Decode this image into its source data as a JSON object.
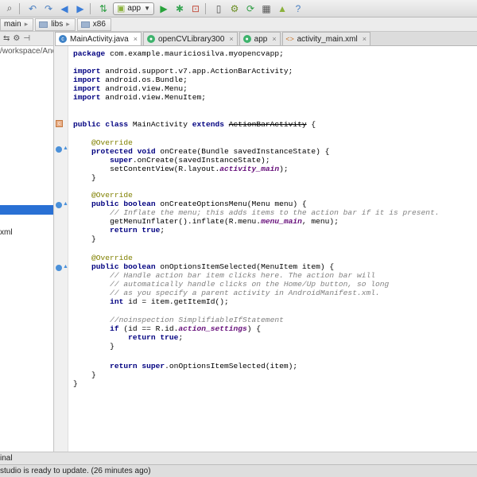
{
  "toolbar": {
    "icons": [
      "search-icon",
      "undo-icon",
      "redo-icon",
      "back-icon",
      "forward-icon",
      "build-icon",
      "run-icon",
      "debug-icon",
      "attach-debugger-icon",
      "avd-icon",
      "sdk-manager-icon",
      "sync-icon",
      "device-monitor-icon",
      "android-icon",
      "help-icon"
    ],
    "run_config_label": "app"
  },
  "breadcrumb": {
    "items": [
      "main",
      "libs",
      "x86"
    ]
  },
  "project_panel": {
    "path_text": "/workspace/And",
    "xml_item_text": "xml"
  },
  "tabs": [
    {
      "label": "MainActivity.java",
      "icon": "class-icon",
      "active": true
    },
    {
      "label": "openCVLibrary300",
      "icon": "module-icon",
      "active": false
    },
    {
      "label": "app",
      "icon": "module-icon",
      "active": false
    },
    {
      "label": "activity_main.xml",
      "icon": "xml-file-icon",
      "active": false
    }
  ],
  "code": {
    "package_kw": "package",
    "package_name": " com.example.mauriciosilva.myopencvapp;",
    "import_kw": "import",
    "imports": [
      " android.support.v7.app.ActionBarActivity;",
      " android.os.Bundle;",
      " android.view.Menu;",
      " android.view.MenuItem;"
    ],
    "class_public": "public",
    "class_kw": "class",
    "class_name": " MainActivity ",
    "extends_kw": "extends",
    "super_class": "ActionBarActivity",
    "brace_open": " {",
    "override": "@Override",
    "protected_kw": "protected",
    "void_kw": "void",
    "oncreate_sig": " onCreate(Bundle savedInstanceState) {",
    "super_kw": "super",
    "oncreate_super": ".onCreate(savedInstanceState);",
    "setcontent_start": "setContentView(R.layout.",
    "activity_main_field": "activity_main",
    "close_paren_semi": ");",
    "close_brace": "}",
    "public_kw": "public",
    "boolean_kw": "boolean",
    "oncreateoptions_sig": " onCreateOptionsMenu(Menu menu) {",
    "comment_inflate": "// Inflate the menu; this adds items to the action bar if it is present.",
    "inflate_start": "getMenuInflater().inflate(R.menu.",
    "menu_main_field": "menu_main",
    "inflate_end": ", menu);",
    "return_kw": "return",
    "true_kw": "true",
    "semi": ";",
    "onoptions_sig": " onOptionsItemSelected(MenuItem item) {",
    "comment_1": "// Handle action bar item clicks here. The action bar will",
    "comment_2": "// automatically handle clicks on the Home/Up button, so long",
    "comment_3": "// as you specify a parent activity in AndroidManifest.xml.",
    "int_kw": "int",
    "int_line_rest": " id = item.getItemId();",
    "noinspection": "//noinspection SimplifiableIfStatement",
    "if_kw": "if",
    "if_start": " (id == R.id.",
    "action_settings_field": "action_settings",
    "if_end": ") {",
    "return_super_rest": ".onOptionsItemSelected(item);"
  },
  "bottom_tool_label": "inal",
  "status_text": "studio is ready to update. (26 minutes ago)",
  "colors": {
    "keyword": "#000080",
    "annotation": "#808000",
    "comment": "#808080",
    "field": "#660e7a",
    "selection": "#2970d4"
  }
}
